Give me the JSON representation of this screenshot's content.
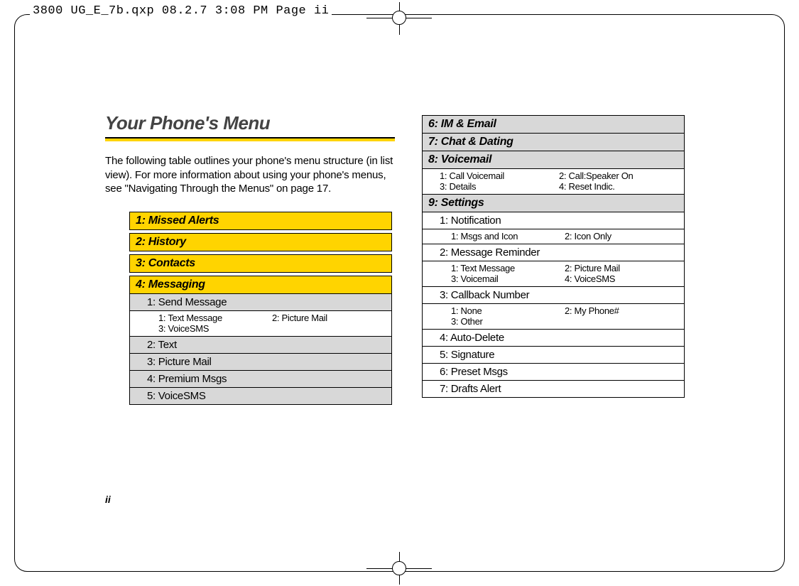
{
  "header_line": "3800 UG_E_7b.qxp  08.2.7  3:08 PM  Page ii",
  "title": "Your Phone's Menu",
  "intro": "The following table outlines your phone's menu structure (in list view). For more information about using your phone's menus, see \"Navigating Through the Menus\" on page 17.",
  "page_number": "ii",
  "left_column": {
    "missed_alerts": "1: Missed Alerts",
    "history": "2: History",
    "contacts": "3: Contacts",
    "messaging": "4: Messaging",
    "messaging_sub": {
      "send_message": "1: Send Message",
      "send_message_opts": [
        "1: Text Message",
        "2: Picture Mail",
        "3: VoiceSMS"
      ],
      "text": "2: Text",
      "picture_mail": "3: Picture Mail",
      "premium_msgs": "4: Premium Msgs",
      "voicesms": "5: VoiceSMS"
    }
  },
  "right_column": {
    "im_email": "6: IM & Email",
    "chat_dating": "7: Chat & Dating",
    "voicemail": "8: Voicemail",
    "voicemail_opts": [
      "1: Call Voicemail",
      "2: Call:Speaker On",
      "3: Details",
      "4: Reset Indic."
    ],
    "settings": "9: Settings",
    "settings_sub": {
      "notification": "1: Notification",
      "notification_opts": [
        "1: Msgs and Icon",
        "2: Icon Only"
      ],
      "message_reminder": "2: Message Reminder",
      "message_reminder_opts": [
        "1: Text Message",
        "2: Picture Mail",
        "3: Voicemail",
        "4: VoiceSMS"
      ],
      "callback_number": "3: Callback Number",
      "callback_number_opts": [
        "1: None",
        "2: My Phone#",
        "3: Other"
      ],
      "auto_delete": "4: Auto-Delete",
      "signature": "5: Signature",
      "preset_msgs": "6: Preset Msgs",
      "drafts_alert": "7: Drafts Alert"
    }
  }
}
